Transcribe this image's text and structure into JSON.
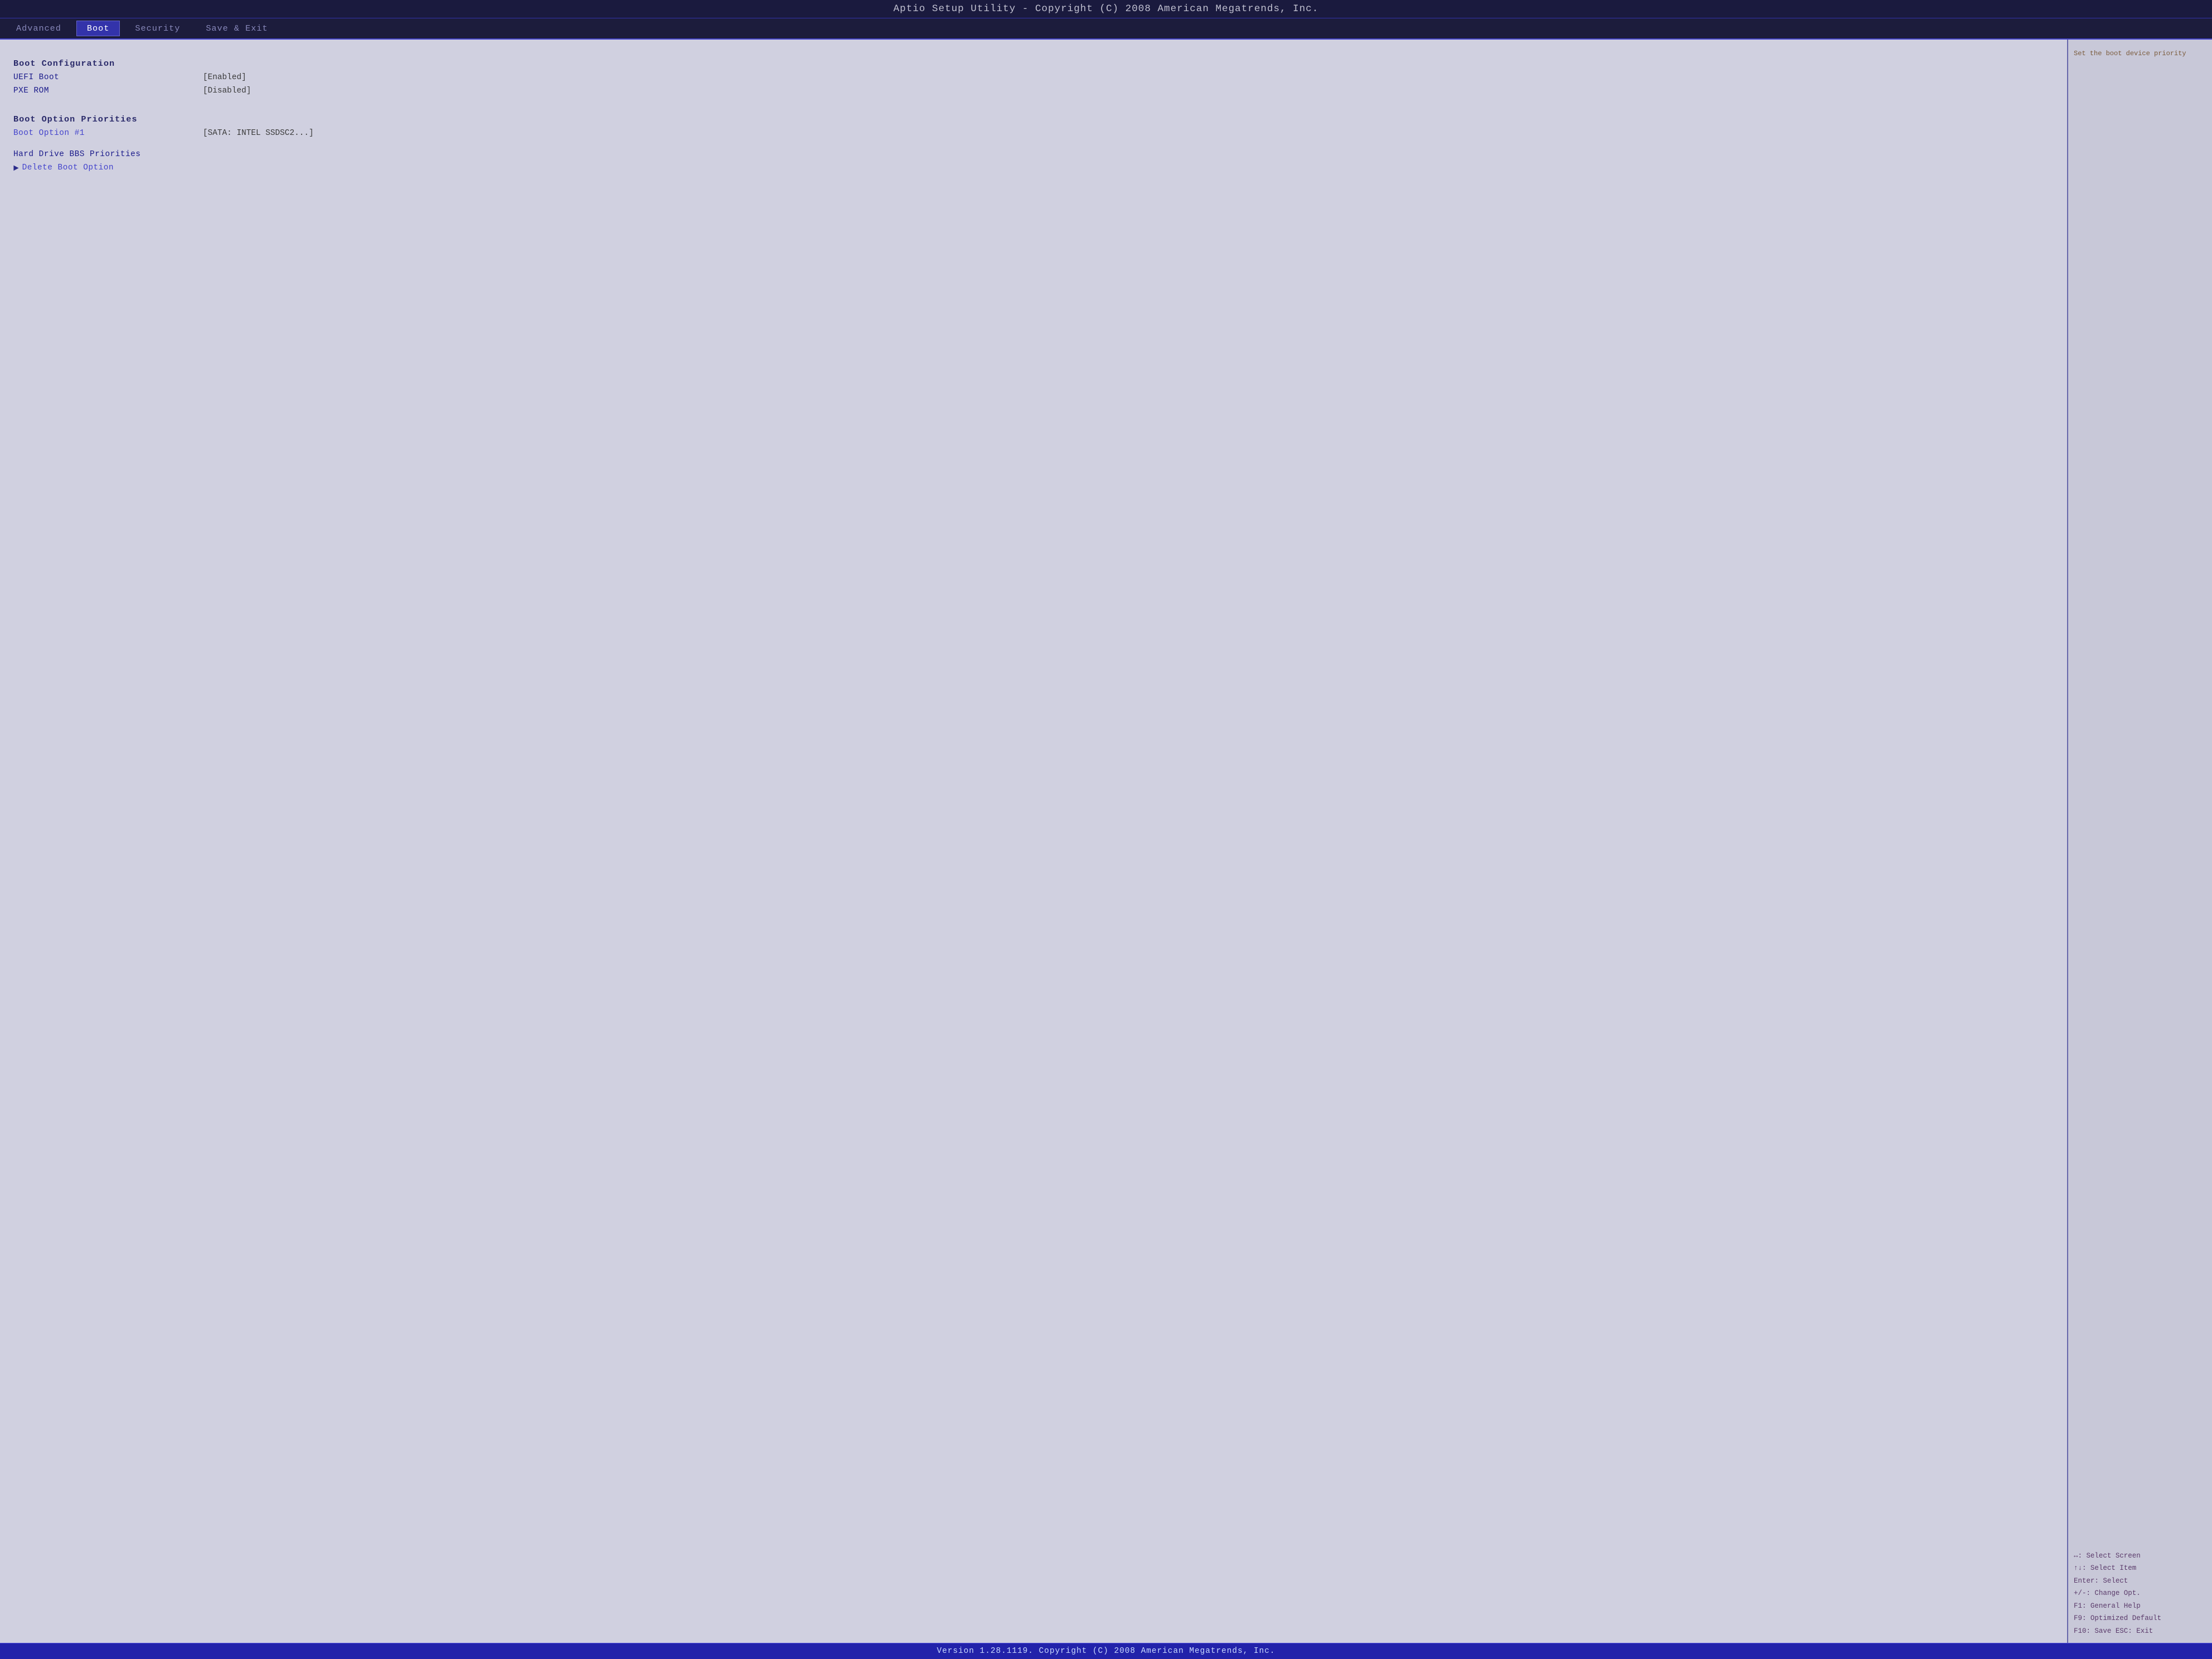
{
  "title_bar": {
    "text": "Aptio Setup Utility - Copyright (C) 2008 American Megatrends, Inc."
  },
  "nav": {
    "tabs": [
      {
        "label": "Advanced",
        "active": false
      },
      {
        "label": "Boot",
        "active": true
      },
      {
        "label": "Security",
        "active": false
      },
      {
        "label": "Save & Exit",
        "active": false
      }
    ]
  },
  "main": {
    "sections": [
      {
        "type": "header",
        "label": "Boot Configuration"
      },
      {
        "type": "row",
        "label": "UEFI Boot",
        "value": "[Enabled]",
        "highlighted": false,
        "arrow": false
      },
      {
        "type": "row",
        "label": "PXE ROM",
        "value": "[Disabled]",
        "highlighted": false,
        "arrow": false
      },
      {
        "type": "spacer"
      },
      {
        "type": "header",
        "label": "Boot Option Priorities"
      },
      {
        "type": "row",
        "label": "Boot Option #1",
        "value": "[SATA: INTEL SSDSC2...]",
        "highlighted": true,
        "arrow": false
      },
      {
        "type": "spacer"
      },
      {
        "type": "row",
        "label": "Hard Drive BBS Priorities",
        "value": "",
        "highlighted": false,
        "arrow": false
      },
      {
        "type": "row",
        "label": "Delete Boot Option",
        "value": "",
        "highlighted": true,
        "arrow": true
      }
    ]
  },
  "right_panel": {
    "help_text": "Set the boot device priority",
    "keys": [
      "↔: Select Screen",
      "↑↓: Select Item",
      "Enter: Select",
      "+/-: Change Opt.",
      "F1: General Help",
      "F9: Optimized Default",
      "F10: Save  ESC: Exit"
    ]
  },
  "status_bar": {
    "text": "Version 1.28.1119. Copyright (C) 2008 American Megatrends, Inc."
  }
}
